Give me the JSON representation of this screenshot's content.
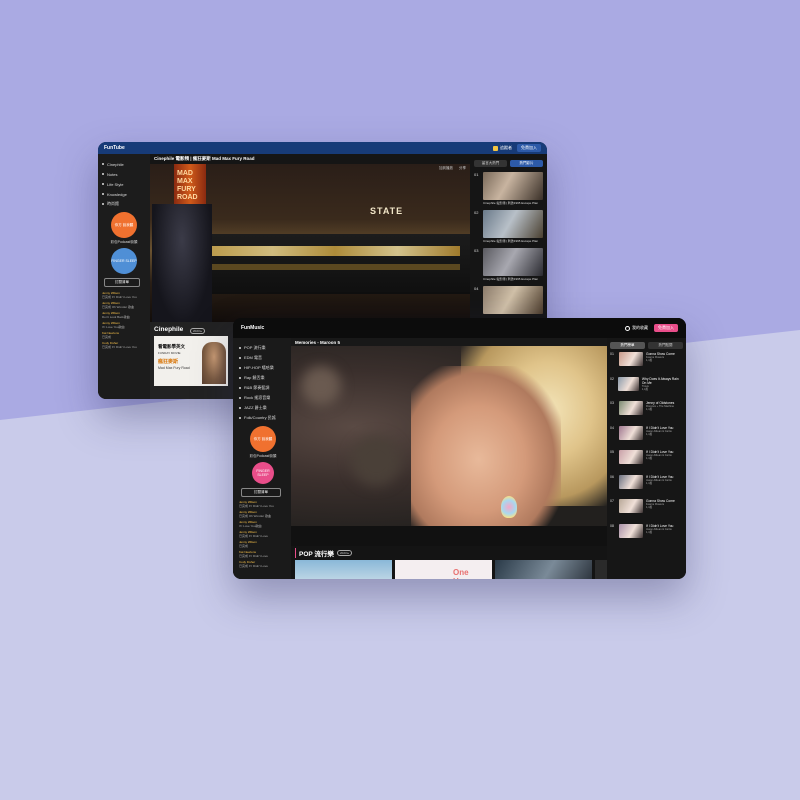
{
  "funtube": {
    "logo": "FunTube",
    "subscribe_label": "追蹤者",
    "join_label": "免費加入",
    "nav": [
      "Cinephile",
      "Notes",
      "Life Style",
      "Knowledge",
      "時尚館"
    ],
    "podcast_label": "彩包Podcast街頭",
    "podcast_icon_text": "你方 說我聽",
    "podcast2_icon_text": "FINGER SLEEP",
    "manage_button": "訂閱清單",
    "chat": [
      {
        "name": "Jenny Wilson",
        "text": "已完成 If I Didn't Love You"
      },
      {
        "name": "Jenny Wilson",
        "text": "已完成 Oh Wonder 歌曲"
      },
      {
        "name": "Jenny Wilson",
        "text": "Don't Look Back歌曲"
      },
      {
        "name": "Jenny Wilson",
        "text": "If I Love You歌曲"
      },
      {
        "name": "Kat Newtons",
        "text": "已完成"
      },
      {
        "name": "Cody Fisher",
        "text": "已完成 If I Didn't Love You"
      }
    ],
    "video_title": "Cinephile 電影頻 | 瘋狂麥斯 Mad Max Fury Road",
    "video_controls": [
      "加到播放",
      "分享"
    ],
    "marquee_text": "MAD MAX FURY ROAD",
    "state_sign": "STATE",
    "section_label": "Cinephile",
    "section_badge": "2023 ▸",
    "card": {
      "title": "看電影學英文",
      "subtitle": "FUNDAY MOVIE",
      "tag": "瘋狂麥斯",
      "name": "Mad Max Fury Road"
    },
    "tabs": [
      "留言大熱門",
      "熱門影片"
    ],
    "playlist": [
      {
        "num": "01",
        "text": "Cinephile 電影頻 | 刺激1995 Escape Plan"
      },
      {
        "num": "02",
        "text": "Cinephile 電影頻 | 刺激1995 Escape Plan"
      },
      {
        "num": "03",
        "text": "Cinephile 電影頻 | 刺激1995 Escape Plan"
      },
      {
        "num": "04",
        "text": ""
      }
    ]
  },
  "funmusic": {
    "logo": "FunMusic",
    "fav_label": "我的收藏",
    "join_label": "免費加入",
    "nav": [
      "POP 流行樂",
      "EDM 電音",
      "HIP-HOP 嘻哈樂",
      "Rap 饒舌樂",
      "R&B 節奏藍調",
      "Rock 搖滾音樂",
      "JAZZ 爵士樂",
      "Folk/Country 民謠"
    ],
    "podcast_icon_text": "你方 說我聽",
    "podcast_label": "彩包Podcast街頭",
    "podcast2_icon_text": "FINGER SLEEP",
    "manage_button": "訂閱清單",
    "chat": [
      {
        "name": "Jenny Wilson",
        "text": "已完成 If I Didn't Love You"
      },
      {
        "name": "Jenny Wilson",
        "text": "已完成 Oh Wonder 歌曲"
      },
      {
        "name": "Jenny Wilson",
        "text": "If I Love You歌曲"
      },
      {
        "name": "Jenny Wilson",
        "text": "已完成 If I Didn't Love"
      },
      {
        "name": "Jenny Wilson",
        "text": "已完成"
      },
      {
        "name": "Kat Newtons",
        "text": "已完成 If I Didn't Love"
      },
      {
        "name": "Cody Fisher",
        "text": "已完成 If I Didn't Love"
      }
    ],
    "video_title": "Memories - Maroon 5",
    "section_label": "POP 流行樂",
    "section_badge": "2023 ▸",
    "tabs": [
      "熱門榜單",
      "熱門點閱"
    ],
    "playlist": [
      {
        "num": "01",
        "title": "Gonna Show Come",
        "sub": "Fearne Flowers",
        "count": "1,4萬"
      },
      {
        "num": "02",
        "title": "Why Does It Always Rain On Me",
        "sub": "Travis",
        "count": "1,4萬"
      },
      {
        "num": "03",
        "title": "Jenny of Oldstones",
        "sub": "Florence + The Machine",
        "count": "1,4萬"
      },
      {
        "num": "04",
        "title": "If I Didn't Love You",
        "sub": "Jason Aldean & Carrie",
        "count": "1,4萬"
      },
      {
        "num": "05",
        "title": "If I Didn't Love You",
        "sub": "Jason Aldean & Carrie",
        "count": "1,4萬"
      },
      {
        "num": "06",
        "title": "If I Didn't Love You",
        "sub": "Jason Aldean & Carrie",
        "count": "1,4萬"
      },
      {
        "num": "07",
        "title": "Gonna Show Come",
        "sub": "Fearne Flowers",
        "count": "1,4萬"
      },
      {
        "num": "08",
        "title": "If I Didn't Love You",
        "sub": "Jason Aldean & Carrie",
        "count": "1,4萬"
      }
    ],
    "pop_thumb_text": "One Hour"
  },
  "colors": {
    "funtube_accent": "#173b78",
    "funmusic_accent": "#e94e8a",
    "background_top": "#aaaae3",
    "background_bottom": "#c9cbea"
  }
}
